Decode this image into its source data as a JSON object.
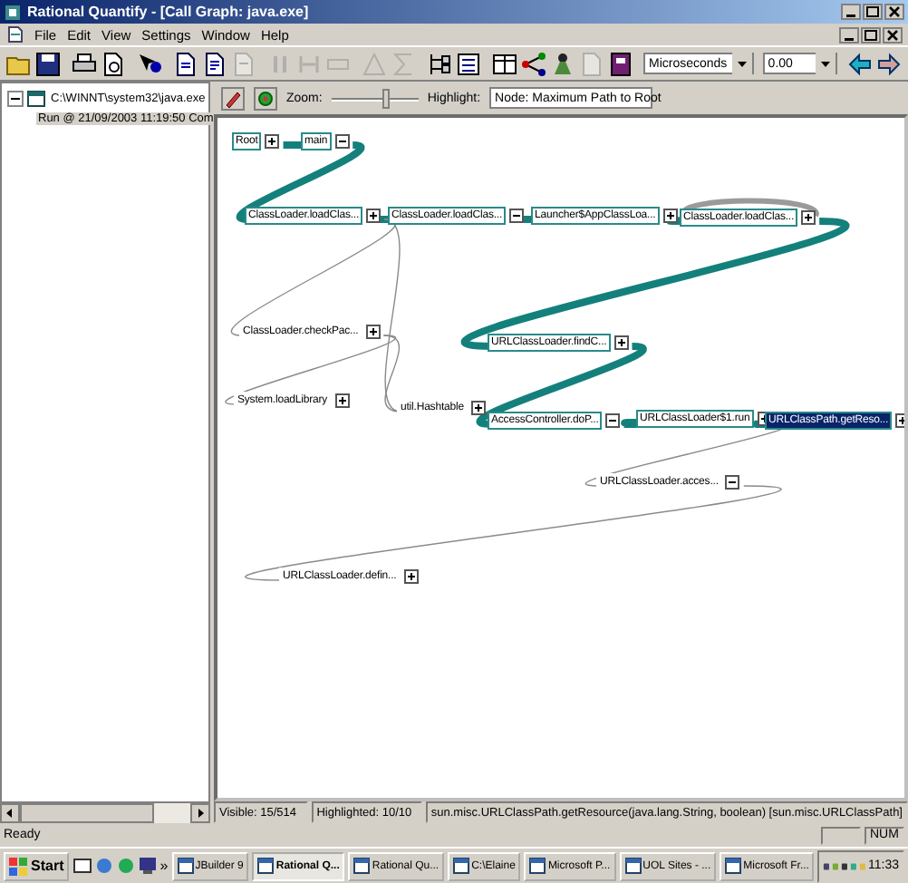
{
  "window": {
    "title": "Rational Quantify - [Call Graph: java.exe]"
  },
  "menu": [
    "File",
    "Edit",
    "View",
    "Settings",
    "Window",
    "Help"
  ],
  "toolbar": {
    "groups": [
      [
        {
          "disabled": false
        },
        {
          "disabled": false
        }
      ],
      [
        {
          "disabled": false
        },
        {
          "disabled": false
        }
      ],
      [
        {
          "disabled": false
        }
      ],
      [
        {
          "disabled": false
        },
        {
          "disabled": false
        },
        {
          "disabled": true
        }
      ],
      [
        {
          "disabled": true
        },
        {
          "disabled": true
        },
        {
          "disabled": true
        }
      ],
      [
        {
          "disabled": true
        },
        {
          "disabled": true
        }
      ],
      [
        {
          "disabled": false
        },
        {
          "disabled": false
        }
      ],
      [
        {
          "disabled": false
        },
        {
          "disabled": false
        },
        {
          "disabled": false
        },
        {
          "disabled": true
        },
        {
          "disabled": false
        }
      ]
    ],
    "units": "Microseconds",
    "threshold": "0.00",
    "nav": [
      {
        "disabled": false
      },
      {
        "disabled": false
      }
    ]
  },
  "tree": [
    {
      "label": "C:\\WINNT\\system32\\java.exe",
      "expanded": true,
      "selected": false,
      "children": [
        {
          "label": "Run @ 21/09/2003 11:19:50 Com",
          "selected": true
        }
      ]
    }
  ],
  "graph_toolbar": {
    "zoom_label": "Zoom:",
    "zoom": {
      "level": 0.62
    },
    "highlight_label": "Highlight:",
    "highlight": "Node: Maximum Path to Root"
  },
  "nodes": [
    {
      "label": "Root",
      "on_path": true,
      "selected": false,
      "expanded": false
    },
    {
      "label": "main",
      "on_path": true,
      "selected": false,
      "expanded": true
    },
    {
      "label": "ClassLoader.loadClas...",
      "on_path": true,
      "selected": false,
      "expanded": false
    },
    {
      "label": "ClassLoader.loadClas...",
      "on_path": true,
      "selected": false,
      "expanded": true
    },
    {
      "label": "Launcher$AppClassLoa...",
      "on_path": true,
      "selected": false,
      "expanded": false
    },
    {
      "label": "ClassLoader.loadClas...",
      "on_path": true,
      "selected": false,
      "expanded": false
    },
    {
      "label": "ClassLoader.checkPac...",
      "on_path": false,
      "selected": false,
      "expanded": false
    },
    {
      "label": "System.loadLibrary",
      "on_path": false,
      "selected": false,
      "expanded": false
    },
    {
      "label": "util.Hashtable",
      "on_path": false,
      "selected": false,
      "expanded": false
    },
    {
      "label": "URLClassLoader.findC...",
      "on_path": true,
      "selected": false,
      "expanded": false
    },
    {
      "label": "AccessController.doP...",
      "on_path": true,
      "selected": false,
      "expanded": true
    },
    {
      "label": "URLClassLoader$1.run",
      "on_path": true,
      "selected": false,
      "expanded": false
    },
    {
      "label": "URLClassPath.getReso...",
      "on_path": true,
      "selected": true,
      "expanded": false
    },
    {
      "label": "URLClassLoader.acces...",
      "on_path": false,
      "selected": false,
      "expanded": true
    },
    {
      "label": "URLClassLoader.defin...",
      "on_path": false,
      "selected": false,
      "expanded": false
    }
  ],
  "graph_status": [
    "Visible: 15/514",
    "Highlighted: 10/10",
    "sun.misc.URLClassPath.getResource(java.lang.String, boolean) [sun.misc.URLClassPath]"
  ],
  "status_bar": {
    "text": "Ready",
    "indicators": [
      "NUM"
    ]
  },
  "taskbar": {
    "start": "Start",
    "quick_launch_more": "»",
    "tasks": [
      {
        "label": "JBuilder 9",
        "selected": false
      },
      {
        "label": "Rational Q...",
        "selected": true
      },
      {
        "label": "Rational Qu...",
        "selected": false
      },
      {
        "label": "C:\\Elaine",
        "selected": false
      },
      {
        "label": "Microsoft P...",
        "selected": false
      },
      {
        "label": "UOL Sites - ...",
        "selected": false
      },
      {
        "label": "Microsoft Fr...",
        "selected": false
      }
    ],
    "clock": "11:33"
  }
}
